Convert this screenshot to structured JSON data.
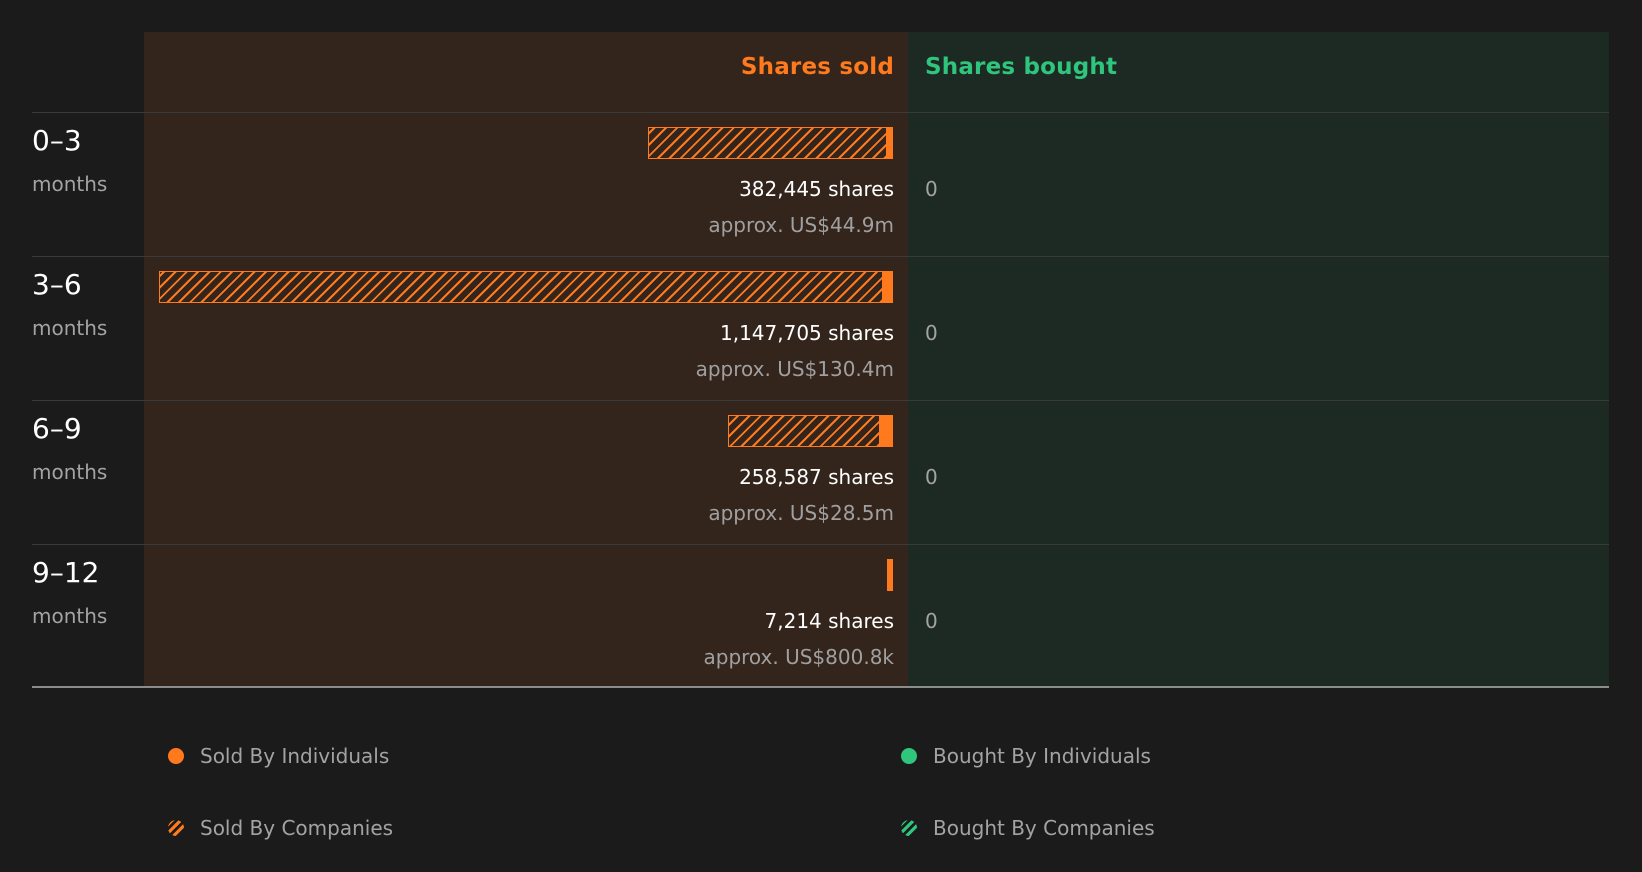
{
  "chart_data": {
    "type": "bar",
    "header": {
      "sold": "Shares sold",
      "bought": "Shares bought"
    },
    "periods": [
      {
        "range": "0–3",
        "unit": "months",
        "sold_shares": 382445,
        "sold_label": "382,445 shares",
        "sold_value": "approx. US$44.9m",
        "individual_share": 0.02,
        "bought": "0"
      },
      {
        "range": "3–6",
        "unit": "months",
        "sold_shares": 1147705,
        "sold_label": "1,147,705 shares",
        "sold_value": "approx. US$130.4m",
        "individual_share": 0.013,
        "bought": "0"
      },
      {
        "range": "6–9",
        "unit": "months",
        "sold_shares": 258587,
        "sold_label": "258,587 shares",
        "sold_value": "approx. US$28.5m",
        "individual_share": 0.08,
        "bought": "0"
      },
      {
        "range": "9–12",
        "unit": "months",
        "sold_shares": 7214,
        "sold_label": "7,214 shares",
        "sold_value": "approx. US$800.8k",
        "individual_share": 1.0,
        "bought": "0"
      }
    ],
    "legend": [
      {
        "label": "Sold By Individuals",
        "color": "#ff7a1c",
        "style": "solid"
      },
      {
        "label": "Bought By Individuals",
        "color": "#2fc57d",
        "style": "solid"
      },
      {
        "label": "Sold By Companies",
        "color": "#ff7a1c",
        "style": "hatched"
      },
      {
        "label": "Bought By Companies",
        "color": "#2fc57d",
        "style": "hatched"
      }
    ],
    "colors": {
      "sold": "#ff7a1c",
      "bought": "#2fc57d"
    }
  }
}
